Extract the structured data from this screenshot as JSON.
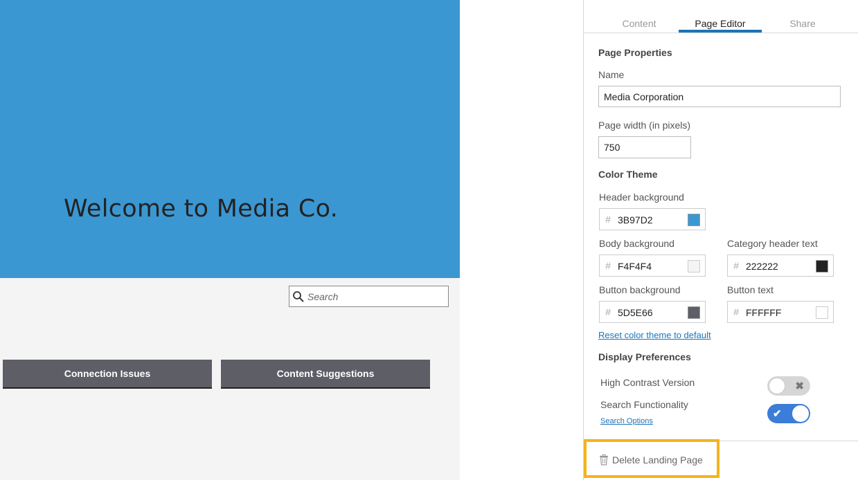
{
  "preview": {
    "title": "Welcome to Media Co.",
    "search_placeholder": "Search",
    "categories": [
      "Connection Issues",
      "Content Suggestions"
    ]
  },
  "tabs": [
    {
      "label": "Content",
      "active": false
    },
    {
      "label": "Page Editor",
      "active": true
    },
    {
      "label": "Share",
      "active": false
    }
  ],
  "page_properties": {
    "heading": "Page Properties",
    "name_label": "Name",
    "name_value": "Media Corporation",
    "width_label": "Page width (in pixels)",
    "width_value": "750"
  },
  "color_theme": {
    "heading": "Color Theme",
    "hash_symbol": "#",
    "header_bg_label": "Header background",
    "header_bg_value": "3B97D2",
    "body_bg_label": "Body background",
    "body_bg_value": "F4F4F4",
    "category_header_label": "Category header text",
    "category_header_value": "222222",
    "button_bg_label": "Button background",
    "button_bg_value": "5D5E66",
    "button_text_label": "Button text",
    "button_text_value": "FFFFFF",
    "reset_link": "Reset color theme to default"
  },
  "display_preferences": {
    "heading": "Display Preferences",
    "high_contrast_label": "High Contrast Version",
    "high_contrast_on": false,
    "search_label": "Search Functionality",
    "search_on": true,
    "search_options_link": "Search Options"
  },
  "delete_label": "Delete Landing Page",
  "colors": {
    "accent": "#1A74B8",
    "highlight": "#F4B41A",
    "toggle_on": "#3B7DD8"
  }
}
